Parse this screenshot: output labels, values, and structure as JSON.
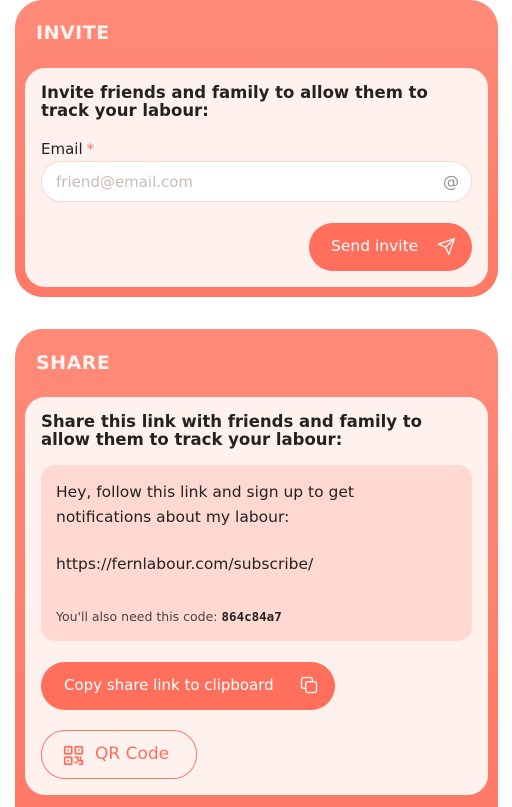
{
  "invite": {
    "title": "INVITE",
    "lead": "Invite friends and family to allow them to track your labour:",
    "email_label": "Email",
    "required_mark": "*",
    "email_placeholder": "friend@email.com",
    "email_value": "",
    "send_label": "Send invite"
  },
  "share": {
    "title": "SHARE",
    "lead": "Share this link with friends and family to allow them to track your labour:",
    "message": "Hey, follow this link and sign up to get notifications about my labour:",
    "link": "https://fernlabour.com/subscribe/",
    "code_prefix": "You'll also need this code:",
    "code": "864c84a7",
    "copy_label": "Copy share link to clipboard",
    "qr_label": "QR Code"
  },
  "colors": {
    "accent": "#ff6f5b",
    "card": "#ff8a78",
    "inner": "#fff1ee",
    "message_bg": "#ffd8d2"
  },
  "icons": {
    "email": "at-icon",
    "send": "paper-plane-icon",
    "copy": "copy-icon",
    "qr": "qr-code-icon"
  }
}
